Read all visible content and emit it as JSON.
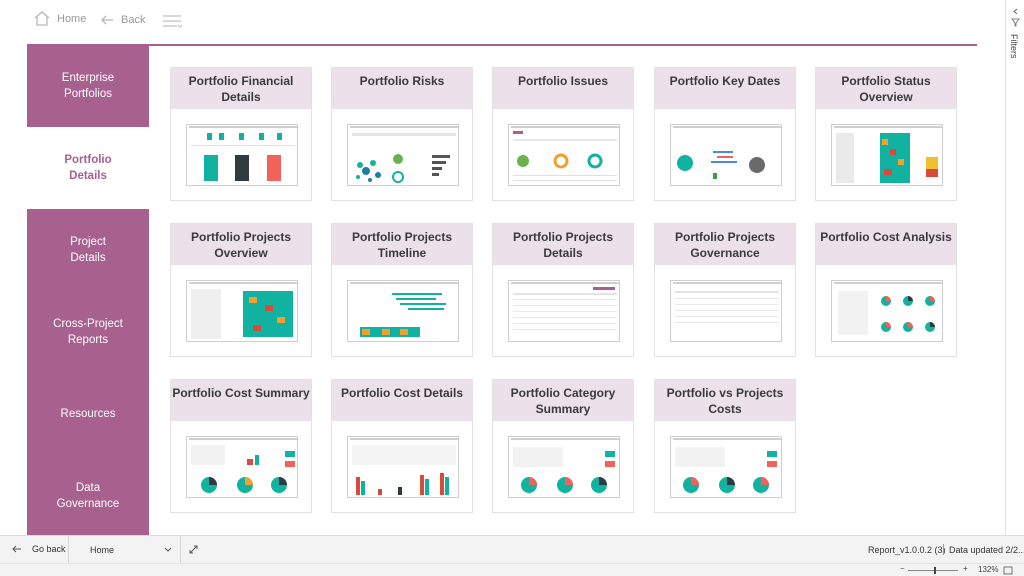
{
  "topbar": {
    "home_label": "Home",
    "back_label": "Back"
  },
  "sidebar": {
    "items": [
      {
        "label": "Enterprise Portfolios"
      },
      {
        "label": "Portfolio Details"
      },
      {
        "label": "Project Details"
      },
      {
        "label": "Cross-Project Reports"
      },
      {
        "label": "Resources"
      },
      {
        "label": "Data Governance"
      }
    ]
  },
  "cards": [
    {
      "title": "Portfolio Financial Details"
    },
    {
      "title": "Portfolio Risks"
    },
    {
      "title": "Portfolio Issues"
    },
    {
      "title": "Portfolio Key Dates"
    },
    {
      "title": "Portfolio Status Overview"
    },
    {
      "title": "Portfolio Projects Overview"
    },
    {
      "title": "Portfolio Projects Timeline"
    },
    {
      "title": "Portfolio Projects Details"
    },
    {
      "title": "Portfolio Projects Governance"
    },
    {
      "title": "Portfolio Cost Analysis"
    },
    {
      "title": "Portfolio Cost Summary"
    },
    {
      "title": "Portfolio Cost Details"
    },
    {
      "title": "Portfolio Category Summary"
    },
    {
      "title": "Portfolio vs Projects Costs"
    }
  ],
  "filters_label": "Filters",
  "bottombar": {
    "go_back_label": "Go back",
    "page_select_value": "Home",
    "version_label": "Report_v1.0.0.2 (3)",
    "data_updated_label": "Data updated 2/2..."
  },
  "statusbar": {
    "zoom_label": "132%"
  },
  "colors": {
    "accent": "#a8608f",
    "card_header": "#ece0ea",
    "teal": "#11b3a0",
    "red": "#f0625a",
    "dark": "#2f3b3f"
  }
}
